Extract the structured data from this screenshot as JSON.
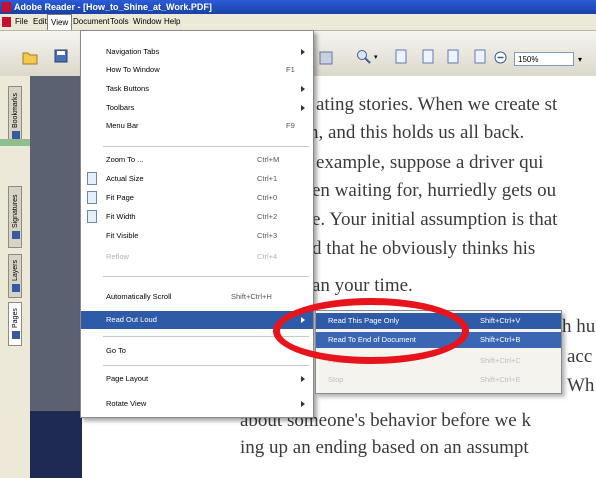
{
  "window": {
    "title": "Adobe Reader - [How_to_Shine_at_Work.PDF]"
  },
  "menubar": {
    "items": [
      "File",
      "Edit",
      "View",
      "Document",
      "Tools",
      "Window",
      "Help"
    ]
  },
  "toolbar": {
    "zoom_value": "150%"
  },
  "sidebar": {
    "tabs": [
      "Bookmarks",
      "Signatures",
      "Layers",
      "Pages"
    ]
  },
  "document": {
    "lines": [
      "ating stories. When we create st",
      "n, and this holds us all back.",
      "example, suppose a driver qui",
      "en waiting for, hurriedly gets ou",
      "e. Your initial assumption is that",
      "d that he obviously thinks his",
      "an your time.",
      "h hu",
      "acc",
      "Wh",
      "about someone's behavior before we k",
      "ing up an ending based on an assumpt"
    ]
  },
  "view_menu": {
    "items": [
      {
        "label": "Navigation Tabs",
        "shortcut": "",
        "submenu": true
      },
      {
        "label": "How To Window",
        "shortcut": "F1",
        "submenu": false
      },
      {
        "label": "Task Buttons",
        "shortcut": "",
        "submenu": true
      },
      {
        "label": "Toolbars",
        "shortcut": "",
        "submenu": true
      },
      {
        "label": "Menu Bar",
        "shortcut": "F9",
        "submenu": false
      },
      {
        "label": "Zoom To ...",
        "shortcut": "Ctrl+M",
        "submenu": false
      },
      {
        "label": "Actual Size",
        "shortcut": "Ctrl+1",
        "submenu": false
      },
      {
        "label": "Fit Page",
        "shortcut": "Ctrl+0",
        "submenu": false
      },
      {
        "label": "Fit Width",
        "shortcut": "Ctrl+2",
        "submenu": false
      },
      {
        "label": "Fit Visible",
        "shortcut": "Ctrl+3",
        "submenu": false
      },
      {
        "label": "Reflow",
        "shortcut": "Ctrl+4",
        "submenu": false
      },
      {
        "label": "Automatically Scroll",
        "shortcut": "Shift+Ctrl+H",
        "submenu": false
      },
      {
        "label": "Read Out Loud",
        "shortcut": "",
        "submenu": true
      },
      {
        "label": "Go To",
        "shortcut": "",
        "submenu": true
      },
      {
        "label": "Page Layout",
        "shortcut": "",
        "submenu": true
      },
      {
        "label": "Rotate View",
        "shortcut": "",
        "submenu": true
      }
    ]
  },
  "read_out_loud_menu": {
    "items": [
      {
        "label": "Read This Page Only",
        "shortcut": "Shift+Ctrl+V"
      },
      {
        "label": "Read To End of Document",
        "shortcut": "Shift+Ctrl+B"
      },
      {
        "label": "Pause",
        "shortcut": "Shift+Ctrl+C"
      },
      {
        "label": "Stop",
        "shortcut": "Shift+Ctrl+E"
      }
    ]
  }
}
